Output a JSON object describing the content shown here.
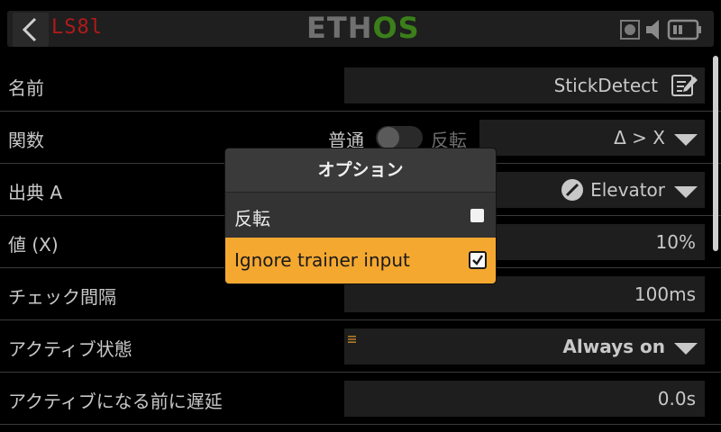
{
  "header": {
    "screen_code": "LS8l",
    "logo_part1": "ETH",
    "logo_part2": "OS"
  },
  "rows": [
    {
      "label": "名前",
      "value": "StickDetect"
    },
    {
      "label": "関数",
      "toggle_left": "普通",
      "toggle_right": "反転",
      "value": "Δ > X"
    },
    {
      "label": "出典 A",
      "value": "Elevator"
    },
    {
      "label": "値 (X)",
      "value": "10%"
    },
    {
      "label": "チェック間隔",
      "value": "100ms"
    },
    {
      "label": "アクティブ状態",
      "value": "Always on"
    },
    {
      "label": "アクティブになる前に遅延",
      "value": "0.0s"
    }
  ],
  "modal": {
    "title": "オプション",
    "options": [
      {
        "label": "反転",
        "checked": false
      },
      {
        "label": "Ignore trainer input",
        "checked": true
      }
    ]
  },
  "colors": {
    "background": "#000000",
    "screen_code": "#b11a1a",
    "logo_green": "#3b7f1a",
    "highlight": "#f5a830"
  }
}
